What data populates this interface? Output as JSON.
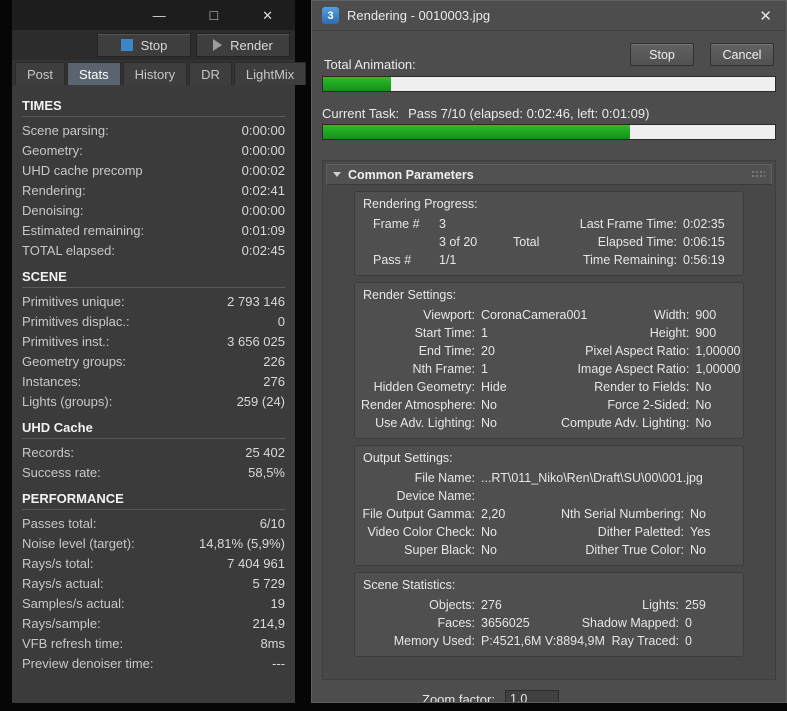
{
  "colors": {
    "progress_green": "#1ca51c",
    "accent_blue": "#3d85c6",
    "active_tab": "#5a646f"
  },
  "vfb": {
    "titlebar": {
      "minimize": "—",
      "maximize": "□",
      "close": "✕"
    },
    "toolbar": {
      "stop": "Stop",
      "render": "Render"
    },
    "tabs": [
      {
        "label": "Post"
      },
      {
        "label": "Stats"
      },
      {
        "label": "History"
      },
      {
        "label": "DR"
      },
      {
        "label": "LightMix"
      }
    ],
    "sections": {
      "times": {
        "title": "TIMES",
        "rows": [
          {
            "label": "Scene parsing:",
            "value": "0:00:00"
          },
          {
            "label": "Geometry:",
            "value": "0:00:00"
          },
          {
            "label": "UHD cache precomp",
            "value": "0:00:02"
          },
          {
            "label": "Rendering:",
            "value": "0:02:41"
          },
          {
            "label": "Denoising:",
            "value": "0:00:00"
          },
          {
            "label": "Estimated remaining:",
            "value": "0:01:09"
          },
          {
            "label": "TOTAL elapsed:",
            "value": "0:02:45"
          }
        ]
      },
      "scene": {
        "title": "SCENE",
        "rows": [
          {
            "label": "Primitives unique:",
            "value": "2 793 146"
          },
          {
            "label": "Primitives displac.:",
            "value": "0"
          },
          {
            "label": "Primitives inst.:",
            "value": "3 656 025"
          },
          {
            "label": "Geometry groups:",
            "value": "226"
          },
          {
            "label": "Instances:",
            "value": "276"
          },
          {
            "label": "Lights (groups):",
            "value": "259 (24)"
          }
        ]
      },
      "uhd": {
        "title": "UHD Cache",
        "rows": [
          {
            "label": "Records:",
            "value": "25 402"
          },
          {
            "label": "Success rate:",
            "value": "58,5%"
          }
        ]
      },
      "performance": {
        "title": "PERFORMANCE",
        "rows": [
          {
            "label": "Passes total:",
            "value": "6/10"
          },
          {
            "label": "Noise level (target):",
            "value": "14,81% (5,9%)"
          },
          {
            "label": "Rays/s total:",
            "value": "7 404 961"
          },
          {
            "label": "Rays/s actual:",
            "value": "5 729"
          },
          {
            "label": "Samples/s actual:",
            "value": "19"
          },
          {
            "label": "Rays/sample:",
            "value": "214,9"
          },
          {
            "label": "VFB refresh time:",
            "value": "8ms"
          },
          {
            "label": "Preview denoiser time:",
            "value": "---"
          }
        ]
      }
    }
  },
  "dialog": {
    "icon_text": "3",
    "title": "Rendering - 0010003.jpg",
    "close": "✕",
    "total_animation_label": "Total Animation:",
    "stop_button": "Stop",
    "cancel_button": "Cancel",
    "total_progress_percent": 15,
    "current_task_label": "Current Task:",
    "current_task_text": "Pass 7/10 (elapsed: 0:02:46, left: 0:01:09)",
    "task_progress_percent": 68,
    "rollout_title": "Common Parameters",
    "groups": {
      "rendering_progress": {
        "title": "Rendering Progress:",
        "rows": [
          {
            "l1": "Frame #",
            "v1": "3",
            "mid": "",
            "l2": "Last Frame Time:",
            "v2": "0:02:35"
          },
          {
            "l1": "",
            "v1": "3 of 20",
            "mid": "Total",
            "l2": "Elapsed Time:",
            "v2": "0:06:15"
          },
          {
            "l1": "Pass #",
            "v1": "1/1",
            "mid": "",
            "l2": "Time Remaining:",
            "v2": "0:56:19"
          }
        ]
      },
      "render_settings": {
        "title": "Render Settings:",
        "rows": [
          {
            "l1": "Viewport:",
            "v1": "CoronaCamera001",
            "l2": "Width:",
            "v2": "900"
          },
          {
            "l1": "Start Time:",
            "v1": "1",
            "l2": "Height:",
            "v2": "900"
          },
          {
            "l1": "End Time:",
            "v1": "20",
            "l2": "Pixel Aspect Ratio:",
            "v2": "1,00000"
          },
          {
            "l1": "Nth Frame:",
            "v1": "1",
            "l2": "Image Aspect Ratio:",
            "v2": "1,00000"
          },
          {
            "l1": "Hidden Geometry:",
            "v1": "Hide",
            "l2": "Render to Fields:",
            "v2": "No"
          },
          {
            "l1": "Render Atmosphere:",
            "v1": "No",
            "l2": "Force 2-Sided:",
            "v2": "No"
          },
          {
            "l1": "Use Adv. Lighting:",
            "v1": "No",
            "l2": "Compute Adv. Lighting:",
            "v2": "No"
          }
        ]
      },
      "output_settings": {
        "title": "Output Settings:",
        "file_name_label": "File Name:",
        "file_name_value": "...RT\\011_Niko\\Ren\\Draft\\SU\\00\\001.jpg",
        "device_name_label": "Device Name:",
        "device_name_value": "",
        "rows": [
          {
            "l1": "File Output Gamma:",
            "v1": "2,20",
            "l2": "Nth Serial Numbering:",
            "v2": "No"
          },
          {
            "l1": "Video Color Check:",
            "v1": "No",
            "l2": "Dither Paletted:",
            "v2": "Yes"
          },
          {
            "l1": "Super Black:",
            "v1": "No",
            "l2": "Dither True Color:",
            "v2": "No"
          }
        ]
      },
      "scene_statistics": {
        "title": "Scene Statistics:",
        "rows": [
          {
            "l1": "Objects:",
            "v1": "276",
            "l2": "Lights:",
            "v2": "259"
          },
          {
            "l1": "Faces:",
            "v1": "3656025",
            "l2": "Shadow Mapped:",
            "v2": "0"
          },
          {
            "l1": "Memory Used:",
            "v1": "P:4521,6M V:8894,9M",
            "l2": "Ray Traced:",
            "v2": "0"
          }
        ]
      }
    },
    "bottom": {
      "zoom_label": "Zoom factor:",
      "zoom_value": "1,0"
    }
  }
}
